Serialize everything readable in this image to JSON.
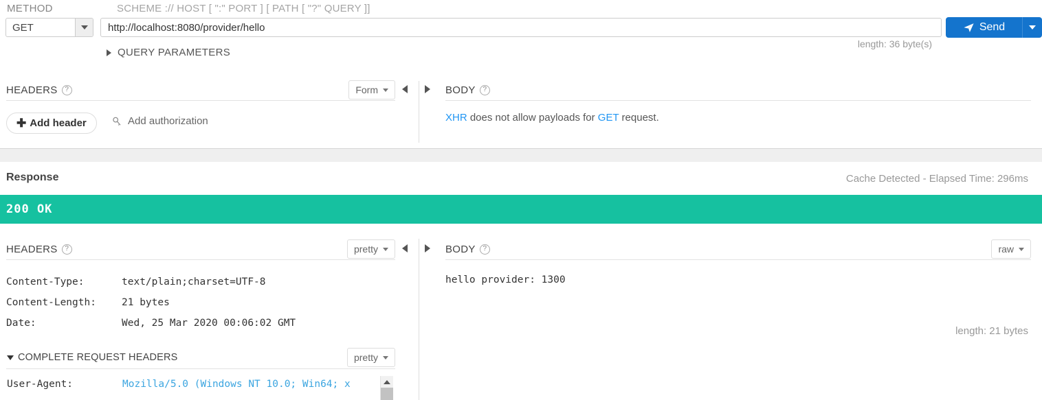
{
  "request": {
    "labels": {
      "method": "METHOD",
      "url": "SCHEME :// HOST [ \":\" PORT ] [ PATH [ \"?\" QUERY ]]"
    },
    "method": {
      "value": "GET",
      "icon": "chevron-down-icon"
    },
    "url": {
      "value": "http://localhost:8080/provider/hello",
      "placeholder": "http://example.com/path"
    },
    "url_length": "length: 36 byte(s)",
    "send": {
      "label": "Send",
      "icon": "send-paper-plane-icon",
      "accent": "#1474cd"
    },
    "query_parameters": {
      "label": "QUERY PARAMETERS",
      "expanded": false,
      "icon": "triangle-right-icon"
    },
    "headers_section": {
      "title": "HEADERS",
      "help": "?",
      "format": "Form",
      "add_header": "Add header",
      "add_authorization": "Add authorization"
    },
    "body_section": {
      "title": "BODY",
      "help": "?",
      "note_prefix": "XHR",
      "note_middle": " does not allow payloads for ",
      "note_method": "GET",
      "note_suffix": " request."
    }
  },
  "response": {
    "title": "Response",
    "meta": "Cache Detected - Elapsed Time: 296ms",
    "status": {
      "text": "200 OK",
      "color": "#16c1a0"
    },
    "headers_section": {
      "title": "HEADERS",
      "help": "?",
      "format": "pretty",
      "rows": [
        {
          "key": "Content-Type:",
          "value": "text/plain;charset=UTF-8"
        },
        {
          "key": "Content-Length:",
          "value": "21 bytes"
        },
        {
          "key": "Date:",
          "value": "Wed, 25 Mar 2020 00:06:02 GMT"
        }
      ]
    },
    "complete_request_headers": {
      "title": "COMPLETE REQUEST HEADERS",
      "expanded": true,
      "format": "pretty",
      "rows": [
        {
          "key": "User-Agent:",
          "value": "Mozilla/5.0 (Windows NT 10.0; Win64; x"
        }
      ]
    },
    "body_section": {
      "title": "BODY",
      "help": "?",
      "format": "raw",
      "content": "hello provider: 1300",
      "length": "length: 21 bytes"
    }
  }
}
